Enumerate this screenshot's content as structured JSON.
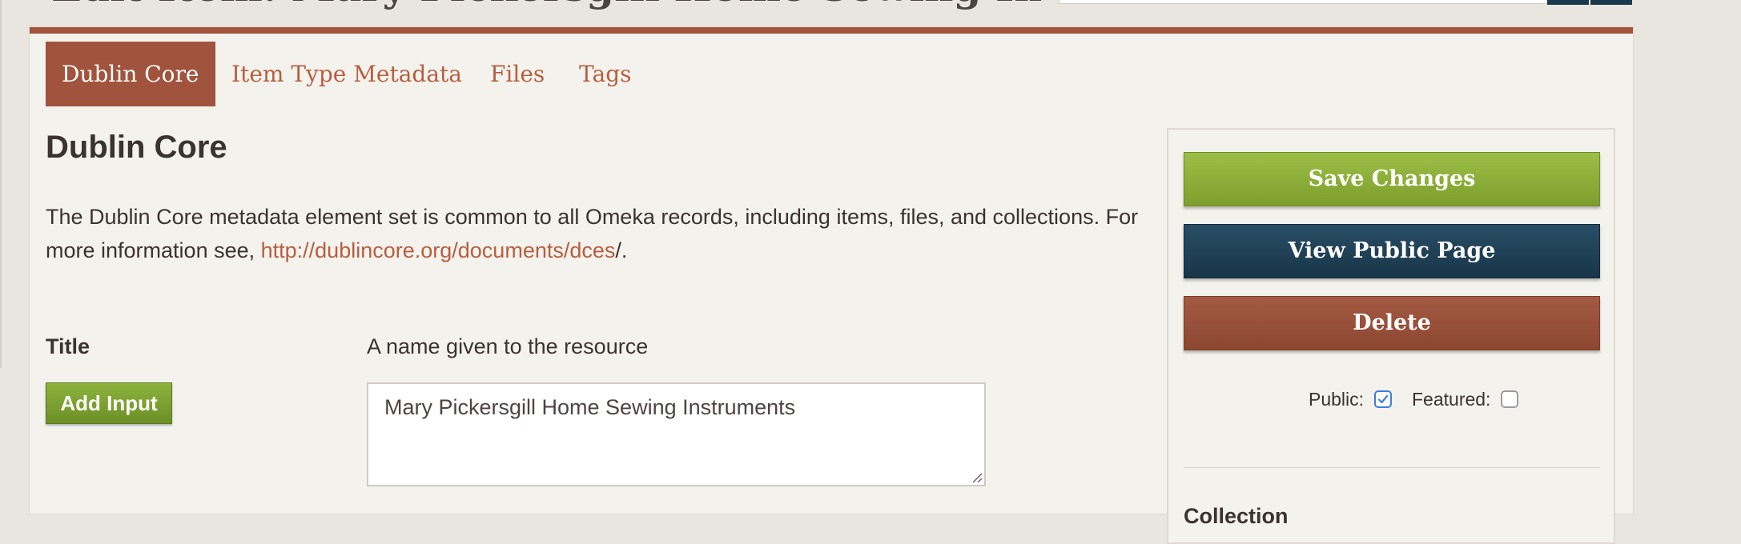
{
  "header": {
    "page_title": "Edit Item: Mary Pickersgill Home Sewing Instruments"
  },
  "tabs": [
    {
      "label": "Dublin Core",
      "active": true
    },
    {
      "label": "Item Type Metadata",
      "active": false
    },
    {
      "label": "Files",
      "active": false
    },
    {
      "label": "Tags",
      "active": false
    }
  ],
  "main": {
    "section_heading": "Dublin Core",
    "description_text": "The Dublin Core metadata element set is common to all Omeka records, including items, files, and collections. For more information see, ",
    "description_link": "http://dublincore.org/documents/dces",
    "description_end": "/.",
    "field": {
      "label": "Title",
      "add_input_label": "Add Input",
      "description": "A name given to the resource",
      "value": "Mary Pickersgill Home Sewing Instruments"
    }
  },
  "sidebar": {
    "save_label": "Save Changes",
    "view_public_label": "View Public Page",
    "delete_label": "Delete",
    "public_label": "Public:",
    "public_checked": true,
    "featured_label": "Featured:",
    "featured_checked": false,
    "collection_heading": "Collection"
  },
  "colors": {
    "accent": "#a0533d",
    "link": "#b65e3f",
    "save": "#8aaf3a",
    "view_public": "#1f4157",
    "delete": "#9a523b",
    "checkbox_checked": "#3d7de0"
  }
}
